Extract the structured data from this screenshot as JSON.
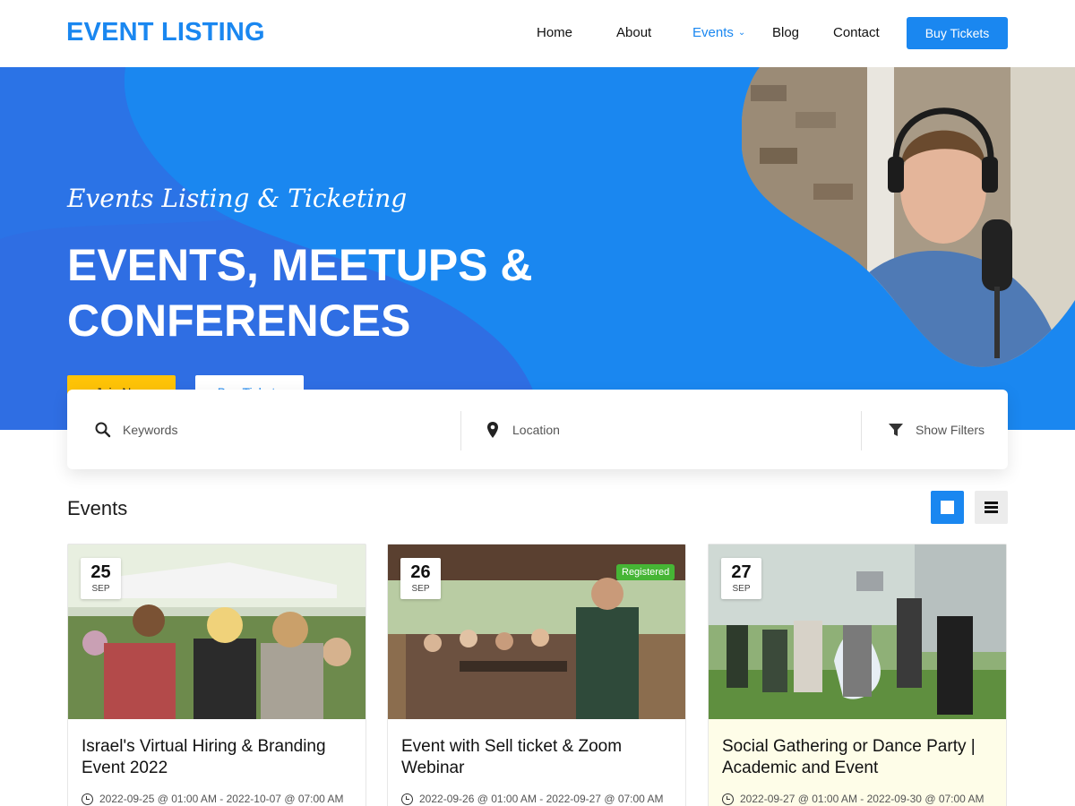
{
  "site": {
    "logo": "EVENT LISTING",
    "nav": [
      {
        "label": "Home"
      },
      {
        "label": "About"
      },
      {
        "label": "Events",
        "active": true
      },
      {
        "label": "Blog"
      },
      {
        "label": "Contact"
      }
    ],
    "cta": "Buy Tickets",
    "accent_color": "#1a87f0",
    "hero_color": "#2f6ee3"
  },
  "hero": {
    "script_title": "Events Listing & Ticketing",
    "title_line1": "EVENTS, MEETUPS &",
    "title_line2": "CONFERENCES",
    "join_label": "Join Now",
    "buy_label": "Buy Tickets",
    "join_color": "#fec307"
  },
  "search": {
    "keywords_placeholder": "Keywords",
    "location_placeholder": "Location",
    "filters_label": "Show Filters"
  },
  "events": {
    "section_title": "Events",
    "cards": [
      {
        "day": "25",
        "month": "SEP",
        "title": "Israel's Virtual Hiring & Branding Event 2022",
        "dates": "2022-09-25 @ 01:00 AM - 2022-10-07 @ 07:00 AM"
      },
      {
        "day": "26",
        "month": "SEP",
        "badge": "Registered",
        "title": "Event with Sell ticket & Zoom Webinar",
        "dates": "2022-09-26 @ 01:00 AM - 2022-09-27 @ 07:00 AM"
      },
      {
        "day": "27",
        "month": "SEP",
        "title": "Social Gathering or Dance Party | Academic and Event",
        "dates": "2022-09-27 @ 01:00 AM - 2022-09-30 @ 07:00 AM"
      }
    ]
  }
}
